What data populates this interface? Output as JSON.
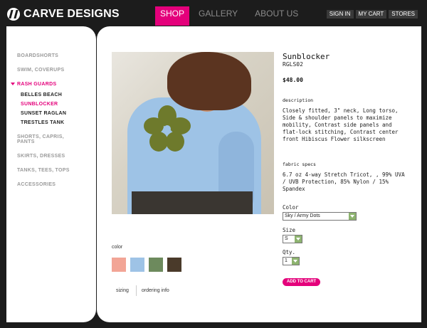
{
  "brand": {
    "name": "CARVE DESIGNS"
  },
  "nav": {
    "shop": "SHOP",
    "gallery": "GALLERY",
    "about": "ABOUT US"
  },
  "utility": {
    "sign_in": "SIGN IN",
    "my_cart": "MY CART",
    "stores": "STORES"
  },
  "sidebar": {
    "boardshorts": "BOARDSHORTS",
    "swim": "SWIM, COVERUPS",
    "rash_guards": "RASH GUARDS",
    "sub": [
      "BELLES BEACH",
      "SUNBLOCKER",
      "SUNSET RAGLAN",
      "TRESTLES TANK"
    ],
    "shorts_line1": "SHORTS, CAPRIS,",
    "shorts_line2": "PANTS",
    "skirts": "SKIRTS, DRESSES",
    "tanks": "TANKS, TEES, TOPS",
    "accessories": "ACCESSORIES"
  },
  "product": {
    "name": "Sunblocker",
    "sku": "RGLS02",
    "price": "$48.00",
    "description_label": "description",
    "description": "Closely fitted, 3\" neck, Long torso, Side & shoulder panels to maximize mobility, Contrast side panels and flat-lock stitching, Contrast center front Hibiscus Flower silkscreen",
    "fabric_label": "fabric specs",
    "fabric": "6.7 oz 4-way Stretch Tricot, , 99% UVA / UVB Protection, 85% Nylon / 15% Spandex"
  },
  "options": {
    "color_label": "Color",
    "color_value": "Sky / Army Dots",
    "size_label": "Size",
    "size_value": "S",
    "qty_label": "Qty.",
    "qty_value": "1"
  },
  "cart_button": "ADD TO CART",
  "swatch_label": "color",
  "swatch_colors": [
    "#f2a596",
    "#9ec3e6",
    "#6d8a5d",
    "#4a3a2a"
  ],
  "links": {
    "sizing": "sizing",
    "ordering": "ordering info"
  },
  "colors": {
    "accent": "#e4007b",
    "background": "#1c1c1c"
  }
}
